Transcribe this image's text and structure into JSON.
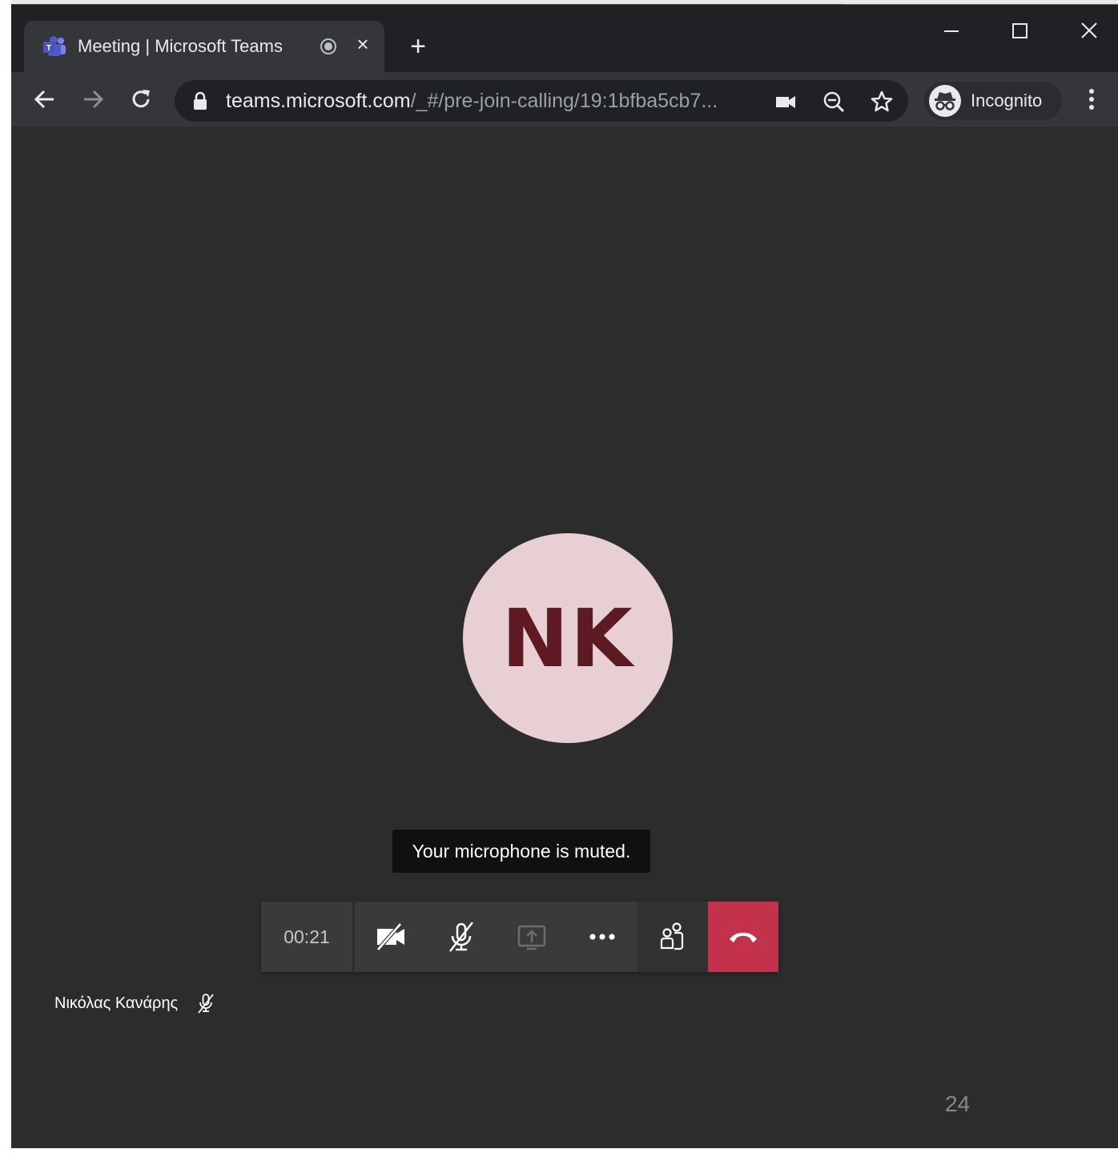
{
  "browser": {
    "tab": {
      "title": "Meeting | Microsoft Teams",
      "close_label": "×",
      "icon": "teams-logo-icon"
    },
    "new_tab_label": "+",
    "address": {
      "host": "teams.microsoft.com",
      "path": "/_#/pre-join-calling/19:1bfba5cb7..."
    },
    "profile": {
      "label": "Incognito",
      "icon": "incognito-icon"
    }
  },
  "meeting": {
    "avatar_initials": "NK",
    "avatar_color": "#e7cfd3",
    "initials_color": "#5e1a22",
    "tooltip": "Your microphone is muted.",
    "callbar": {
      "timer": "00:21",
      "hangup_color": "#c4314b"
    },
    "self_name": "Νικόλας Κανάρης",
    "page_number": "24"
  }
}
